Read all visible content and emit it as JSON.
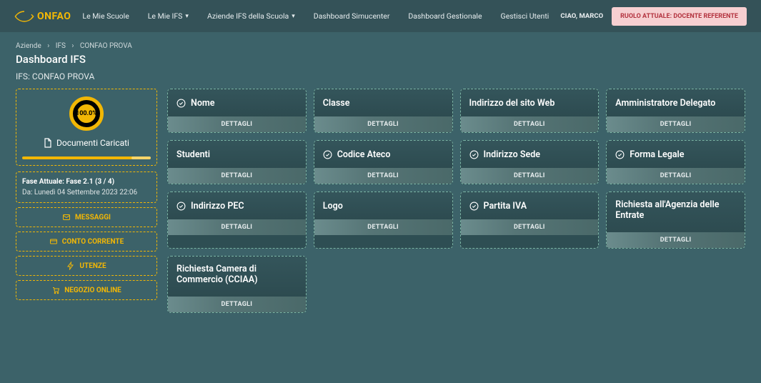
{
  "header": {
    "logo_text": "ONFAO",
    "nav": [
      "Le Mie Scuole",
      "Le Mie IFS",
      "Aziende IFS della Scuola",
      "Dashboard Simucenter",
      "Dashboard Gestionale",
      "Gestisci Utenti"
    ],
    "greeting": "CIAO, MARCO",
    "role_badge": "RUOLO ATTUALE: DOCENTE REFERENTE"
  },
  "breadcrumbs": [
    "Aziende",
    "IFS",
    "CONFAO PROVA"
  ],
  "page_title": "Dashboard IFS",
  "subtitle": "IFS: CONFAO PROVA",
  "sidebar": {
    "gauge_percent": "100.0%",
    "docs_label": "Documenti Caricati",
    "phase_line1": "Fase Attuale: Fase 2.1 (3 / 4)",
    "phase_line2": "Da: Lunedì 04 Settembre 2023 22:06",
    "buttons": [
      "MESSAGGI",
      "CONTO CORRENTE",
      "UTENZE",
      "NEGOZIO ONLINE"
    ]
  },
  "cards": [
    {
      "title": "Nome",
      "checked": true,
      "tall": false
    },
    {
      "title": "Classe",
      "checked": false,
      "tall": false
    },
    {
      "title": "Indirizzo del sito Web",
      "checked": false,
      "tall": false
    },
    {
      "title": "Amministratore Delegato",
      "checked": false,
      "tall": false
    },
    {
      "title": "Studenti",
      "checked": false,
      "tall": false
    },
    {
      "title": "Codice Ateco",
      "checked": true,
      "tall": false
    },
    {
      "title": "Indirizzo Sede",
      "checked": true,
      "tall": false
    },
    {
      "title": "Forma Legale",
      "checked": true,
      "tall": false
    },
    {
      "title": "Indirizzo PEC",
      "checked": true,
      "tall": false
    },
    {
      "title": "Logo",
      "checked": false,
      "tall": false
    },
    {
      "title": "Partita IVA",
      "checked": true,
      "tall": false
    },
    {
      "title": "Richiesta all'Agenzia delle Entrate",
      "checked": false,
      "tall": true
    },
    {
      "title": "Richiesta Camera di Commercio (CCIAA)",
      "checked": false,
      "tall": true
    }
  ],
  "detail_label": "DETTAGLI"
}
